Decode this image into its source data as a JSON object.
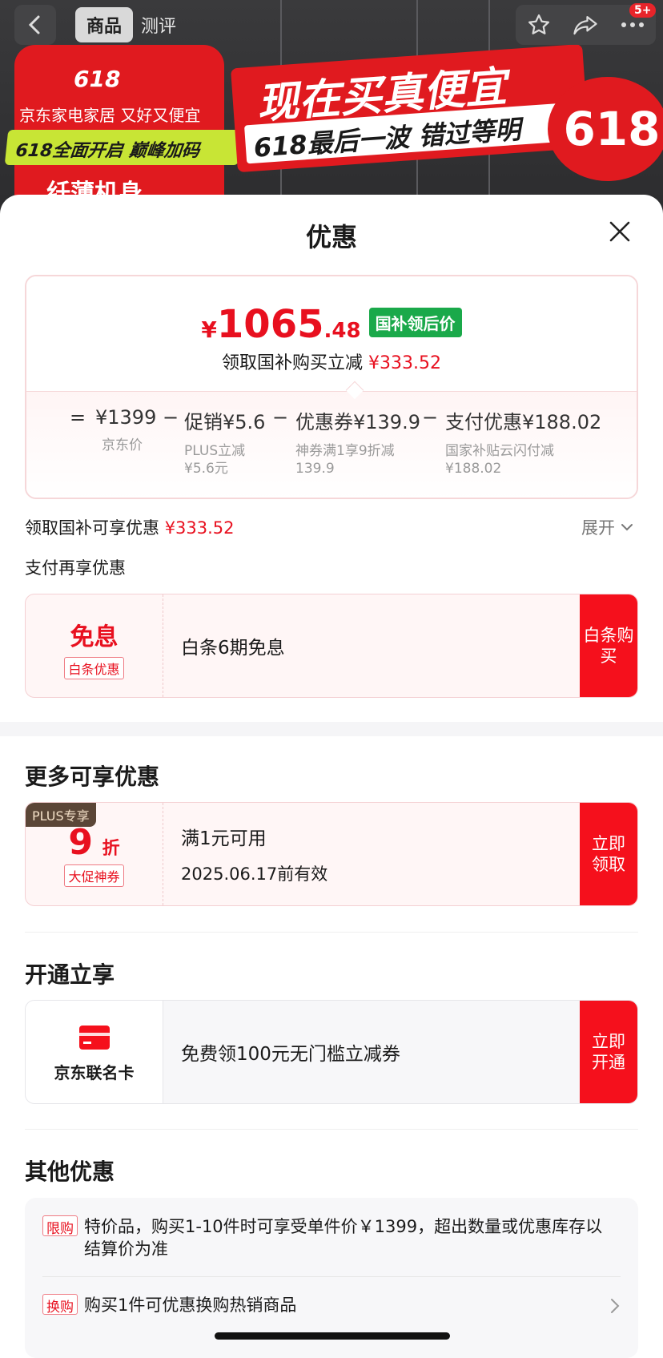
{
  "nav": {
    "tab_product": "商品",
    "tab_review": "测评",
    "badge": "5+"
  },
  "banner": {
    "logo": "618",
    "left_line1": "京东家电家居 又好又便宜",
    "left_line2": "618全面开启 巅峰加码",
    "left_line3": "纤薄机身",
    "right_headline": "现在买真便宜",
    "right_sub": "618最后一波 错过等明",
    "circle": "618"
  },
  "sheet": {
    "title": "优惠"
  },
  "price": {
    "yen": "¥",
    "int": "1065",
    "dec": ".48",
    "tag": "国补领后价",
    "save_text": "领取国补购买立减",
    "save_amount": "¥333.52"
  },
  "formula": {
    "eq": "=",
    "minus": "−",
    "items": [
      {
        "value": "¥1399",
        "desc1": "京东价",
        "desc2": ""
      },
      {
        "value": "促销¥5.6",
        "desc1": "PLUS立减",
        "desc2": "¥5.6元"
      },
      {
        "value": "优惠券¥139.9",
        "desc1": "神券满1享9折减",
        "desc2": "139.9"
      },
      {
        "value": "支付优惠¥188.02",
        "desc1": "国家补贴云闪付减",
        "desc2": "¥188.02"
      }
    ]
  },
  "gov": {
    "text": "领取国补可享优惠",
    "amount": "¥333.52",
    "expand": "展开"
  },
  "pay": {
    "title": "支付再享优惠",
    "coupon": {
      "big": "免息",
      "tag": "白条优惠",
      "text": "白条6期免息",
      "action": "白条购买"
    }
  },
  "more": {
    "title": "更多可享优惠",
    "coupon": {
      "plus_tag": "PLUS专享",
      "big": "9",
      "unit": "折",
      "tag": "大促神券",
      "line1": "满1元可用",
      "line2": "2025.06.17前有效",
      "action": "立即领取"
    }
  },
  "open": {
    "title": "开通立享",
    "card": {
      "name": "京东联名卡",
      "text": "免费领100元无门槛立减券",
      "action": "立即开通"
    }
  },
  "other": {
    "title": "其他优惠",
    "rows": [
      {
        "tag": "限购",
        "text": "特价品，购买1-10件时可享受单件价￥1399，超出数量或优惠库存以结算价为准"
      },
      {
        "tag": "换购",
        "text": "购买1件可优惠换购热销商品"
      }
    ]
  },
  "colors": {
    "accent_red": "#e8101f",
    "green_tag": "#1aa94a",
    "action_red": "#f5101c"
  }
}
